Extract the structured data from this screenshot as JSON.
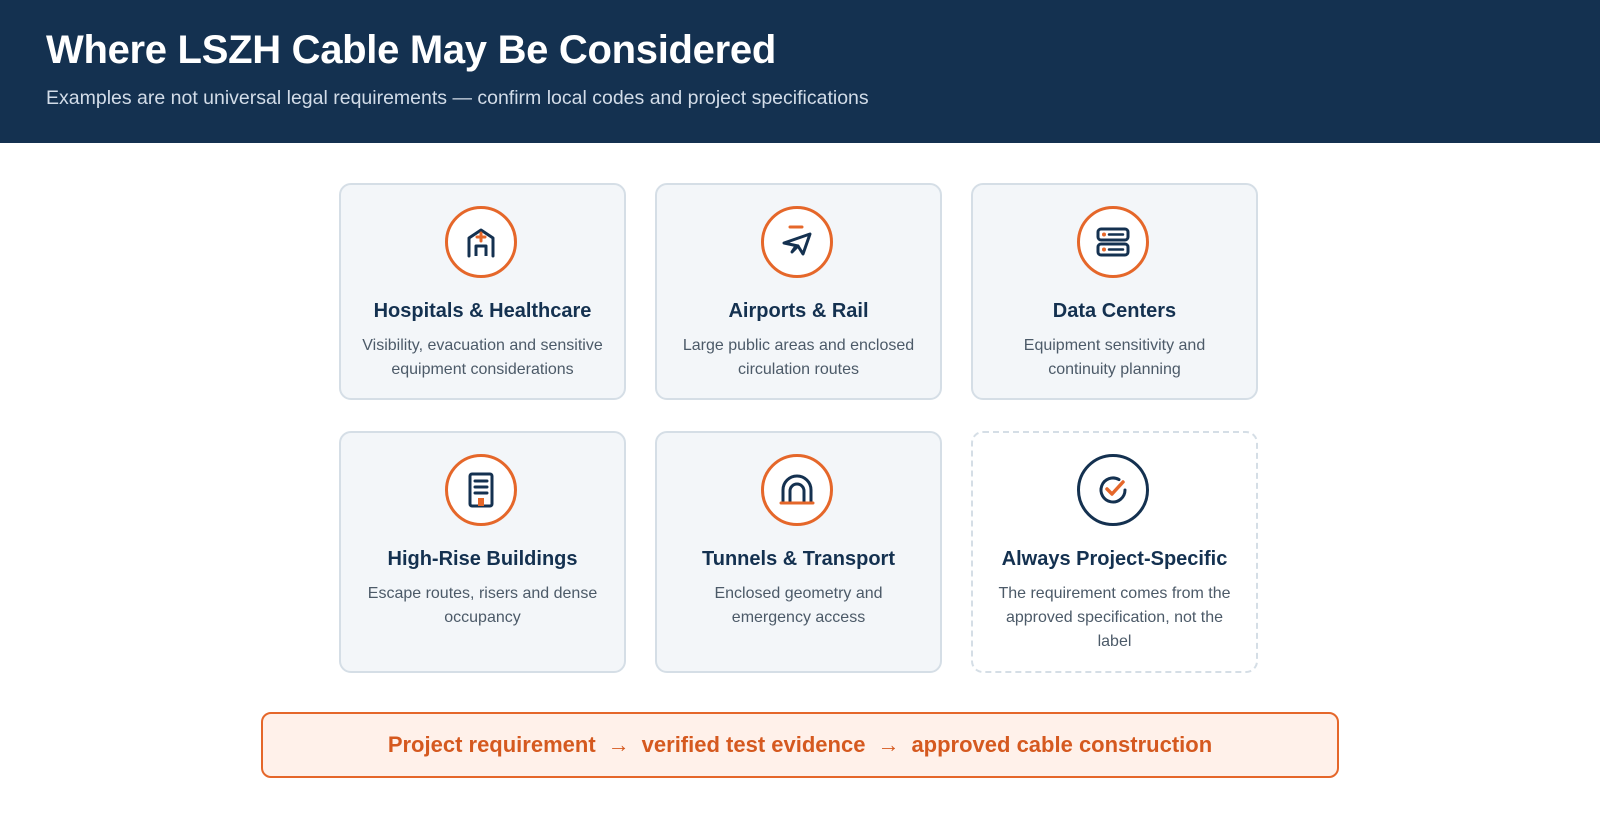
{
  "header": {
    "title": "Where LSZH Cable May Be Considered",
    "subtitle": "Examples are not universal legal requirements — confirm local codes and project specifications"
  },
  "cards": [
    {
      "title": "Hospitals & Healthcare",
      "description": "Visibility, evacuation and sensitive equipment considerations",
      "icon": "hospital-icon"
    },
    {
      "title": "Airports & Rail",
      "description": "Large public areas and enclosed circulation routes",
      "icon": "airplane-icon"
    },
    {
      "title": "Data Centers",
      "description": "Equipment sensitivity and continuity planning",
      "icon": "server-icon"
    },
    {
      "title": "High-Rise Buildings",
      "description": "Escape routes, risers and dense occupancy",
      "icon": "building-icon"
    },
    {
      "title": "Tunnels & Transport",
      "description": "Enclosed geometry and emergency access",
      "icon": "tunnel-icon"
    },
    {
      "title": "Always Project-Specific",
      "description": "The requirement comes from the approved specification, not the label",
      "icon": "check-circle-icon"
    }
  ],
  "banner": {
    "step1": "Project requirement",
    "arrow1": "→",
    "step2": "verified test evidence",
    "arrow2": "→",
    "step3": "approved cable construction"
  },
  "colors": {
    "header_bg": "#143150",
    "accent": "#e5672a",
    "navy": "#143150",
    "card_bg": "#f3f6f9",
    "card_border": "#d5dee6",
    "banner_bg": "#fff1ea"
  }
}
